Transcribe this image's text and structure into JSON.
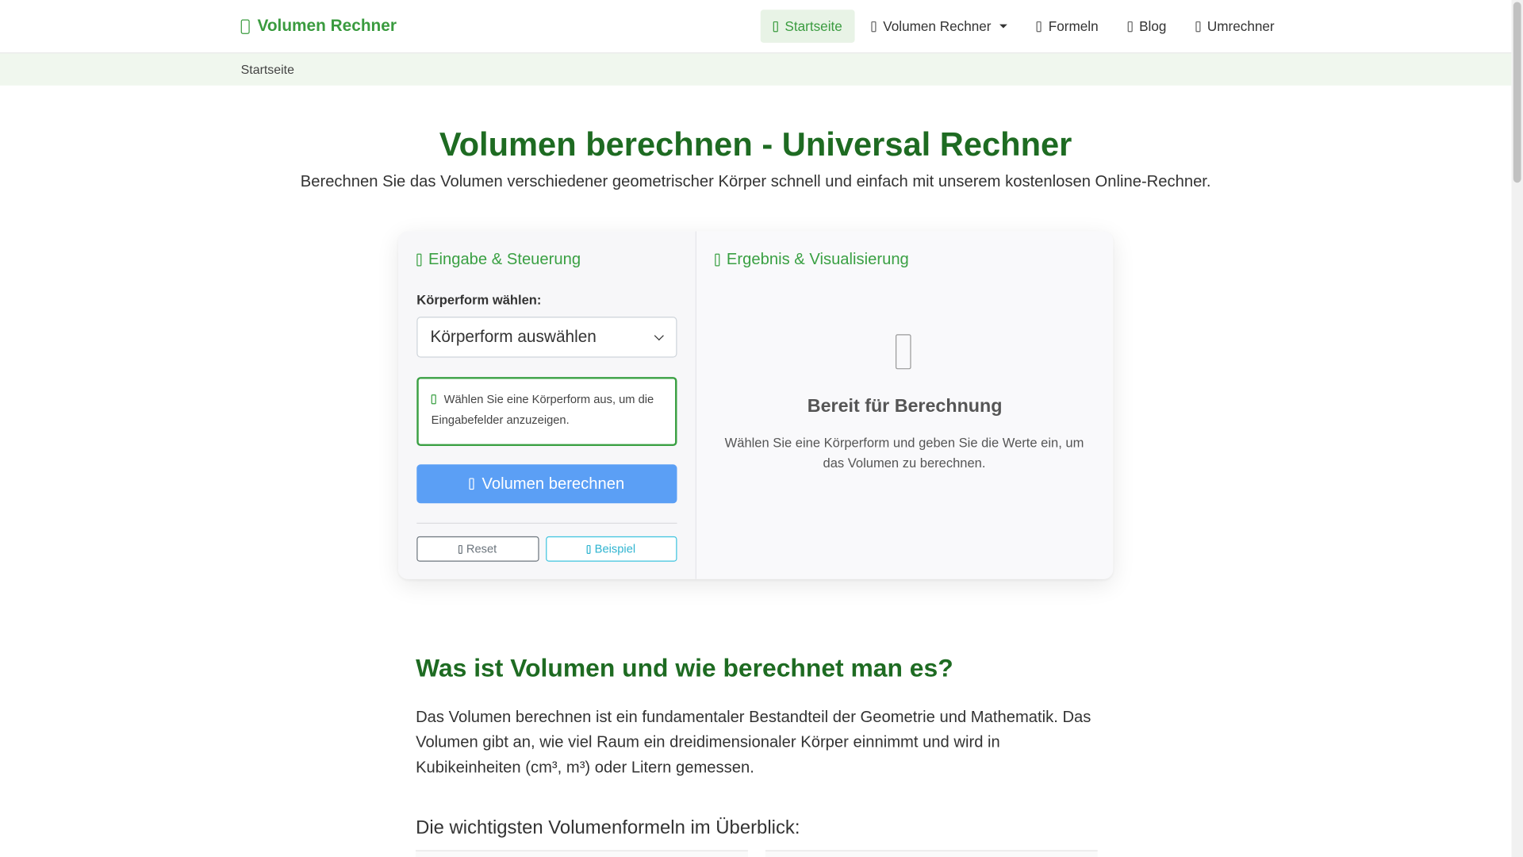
{
  "brand": {
    "name": "Volumen Rechner"
  },
  "nav": {
    "items": [
      {
        "label": "Startseite",
        "active": true
      },
      {
        "label": "Volumen Rechner",
        "dropdown": true
      },
      {
        "label": "Formeln"
      },
      {
        "label": "Blog"
      },
      {
        "label": "Umrechner"
      }
    ]
  },
  "breadcrumb": {
    "current": "Startseite"
  },
  "hero": {
    "title": "Volumen berechnen - Universal Rechner",
    "subtitle": "Berechnen Sie das Volumen verschiedener geometrischer Körper schnell und einfach mit unserem kostenlosen Online-Rechner."
  },
  "calculator": {
    "input_title": "Eingabe & Steuerung",
    "shape_label": "Körperform wählen:",
    "shape_select": {
      "selected": "Körperform auswählen"
    },
    "hint": "Wählen Sie eine Körperform aus, um die Eingabefelder anzuzeigen.",
    "calc_button": "Volumen berechnen",
    "reset_button": "Reset",
    "example_button": "Beispiel",
    "result_title": "Ergebnis & Visualisierung",
    "ready_title": "Bereit für Berechnung",
    "ready_text": "Wählen Sie eine Körperform und geben Sie die Werte ein, um das Volumen zu berechnen."
  },
  "article": {
    "heading": "Was ist Volumen und wie berechnet man es?",
    "paragraph": "Das Volumen berechnen ist ein fundamentaler Bestandteil der Geometrie und Mathematik. Das Volumen gibt an, wie viel Raum ein dreidimensionaler Körper einnimmt und wird in Kubikeinheiten (cm³, m³) oder Litern gemessen.",
    "subheading": "Die wichtigsten Volumenformeln im Überblick:"
  },
  "colors": {
    "brand_green": "#3a9b3f",
    "heading_green": "#1e6b22",
    "primary_button": "#5b9ff5",
    "info_button": "#3ec3de"
  }
}
